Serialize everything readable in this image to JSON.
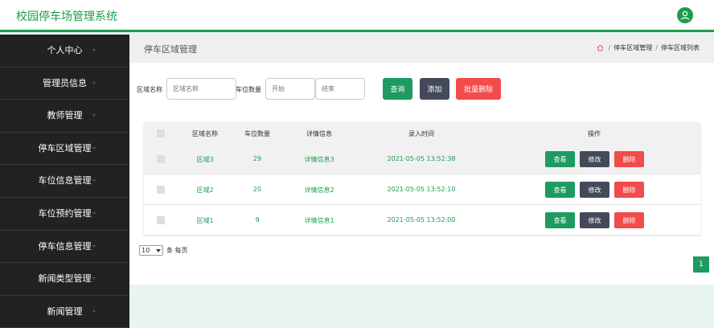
{
  "app": {
    "title": "校园停车场管理系统"
  },
  "sidebar": {
    "items": [
      {
        "label": "个人中心"
      },
      {
        "label": "管理员信息"
      },
      {
        "label": "教师管理"
      },
      {
        "label": "停车区域管理"
      },
      {
        "label": "车位信息管理"
      },
      {
        "label": "车位预约管理"
      },
      {
        "label": "停车信息管理"
      },
      {
        "label": "新闻类型管理"
      },
      {
        "label": "新闻管理"
      }
    ]
  },
  "page": {
    "title": "停车区域管理",
    "breadcrumb": [
      "停车区域管理",
      "停车区域列表"
    ],
    "breadcrumb_sep": "/"
  },
  "search": {
    "area_label": "区域名称",
    "area_placeholder": "区域名称",
    "count_label": "车位数量",
    "start_placeholder": "开始",
    "end_placeholder": "结束",
    "query_btn": "查询",
    "add_btn": "添加",
    "batch_delete_btn": "批量删除"
  },
  "table": {
    "headers": [
      "区域名称",
      "车位数量",
      "详情信息",
      "录入时间",
      "操作"
    ],
    "rows": [
      {
        "name": "区域3",
        "count": "29",
        "detail": "详情信息3",
        "time": "2021-05-05 13:52:38"
      },
      {
        "name": "区域2",
        "count": "20",
        "detail": "详情信息2",
        "time": "2021-05-05 13:52:10"
      },
      {
        "name": "区域1",
        "count": "9",
        "detail": "详情信息1",
        "time": "2021-05-05 13:52:00"
      }
    ],
    "actions": {
      "view": "查看",
      "edit": "修改",
      "delete": "删除"
    }
  },
  "pagination": {
    "page_size": "10",
    "per_page_label": "条 每页",
    "current_page": "1"
  },
  "colors": {
    "accent": "#1e9b4d",
    "danger": "#f24b4b",
    "dark": "#444a5a",
    "sidebar": "#222222"
  }
}
